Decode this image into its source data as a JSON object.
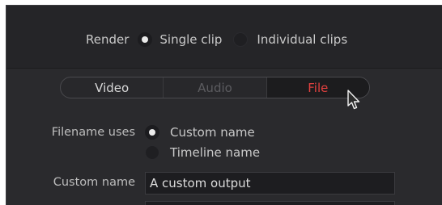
{
  "render": {
    "label": "Render",
    "options": [
      {
        "label": "Single clip",
        "selected": true
      },
      {
        "label": "Individual clips",
        "selected": false
      }
    ]
  },
  "tabs": [
    {
      "label": "Video",
      "state": "normal"
    },
    {
      "label": "Audio",
      "state": "disabled"
    },
    {
      "label": "File",
      "state": "active"
    }
  ],
  "filename": {
    "label": "Filename uses",
    "options": [
      {
        "label": "Custom name",
        "selected": true
      },
      {
        "label": "Timeline name",
        "selected": false
      }
    ]
  },
  "custom_name": {
    "label": "Custom name",
    "value": "A custom output"
  },
  "colors": {
    "panel_bg": "#2a2a2d",
    "active_tab_text": "#e2413f",
    "text": "#c9c9c9"
  },
  "cursor_icon": "mouse-pointer-icon"
}
